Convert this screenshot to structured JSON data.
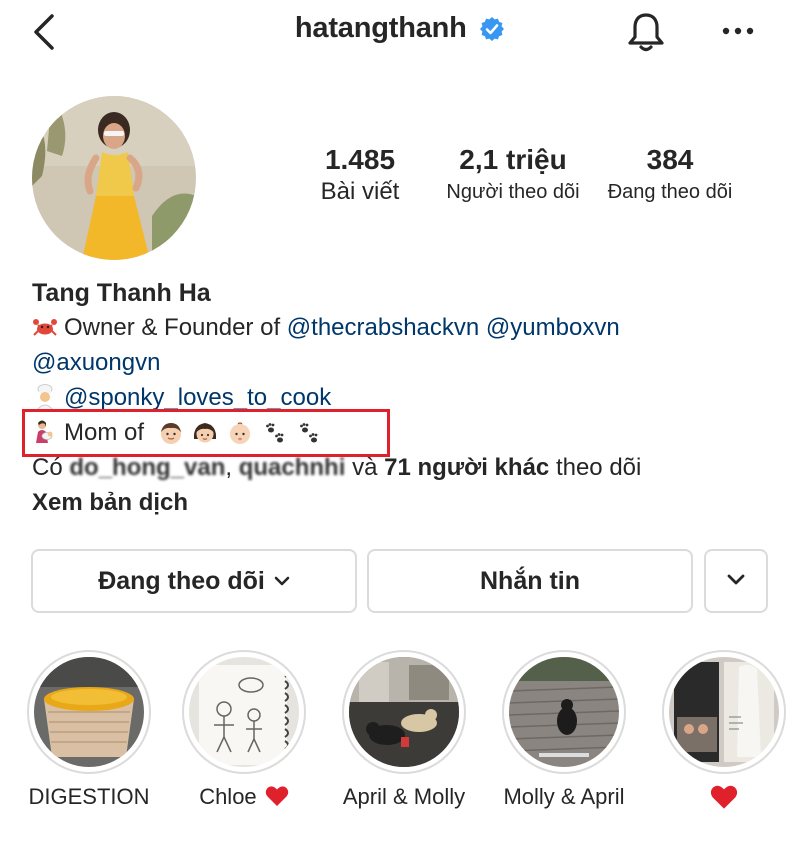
{
  "header": {
    "username": "hatangthanh",
    "back_icon": "chevron-left-icon",
    "verified_icon": "verified-badge-icon",
    "bell_icon": "bell-icon",
    "more_icon": "more-horizontal-icon",
    "verified_color": "#3897f0"
  },
  "stats": {
    "posts_count": "1.485",
    "posts_label": "Bài viết",
    "followers_count": "2,1 triệu",
    "followers_label": "Người theo dõi",
    "following_count": "384",
    "following_label": "Đang theo dõi"
  },
  "bio": {
    "name": "Tang Thanh Ha",
    "line1_text": "Owner & Founder of",
    "mention1": "@thecrabshackvn",
    "mention2": "@yumboxvn",
    "mention3": "@axuongvn",
    "mention4": "@sponky_loves_to_cook",
    "mom_text": "Mom of",
    "followed_prefix": "Có",
    "followed_user1": "do_hong_van",
    "followed_user2": "quachnhi",
    "followed_and": "và",
    "followed_others": "71 người khác",
    "followed_suffix": "theo dõi",
    "see_translation": "Xem bản dịch"
  },
  "buttons": {
    "following_label": "Đang theo dõi",
    "message_label": "Nhắn tin"
  },
  "highlights": [
    {
      "label": "DIGESTION"
    },
    {
      "label": "Chloe"
    },
    {
      "label": "April & Molly"
    },
    {
      "label": "Molly & April"
    },
    {
      "label": ""
    }
  ],
  "colors": {
    "mention": "#00376b",
    "highlight_box": "#e0202b",
    "heart": "#e0202b",
    "border": "#dbdbdb"
  }
}
